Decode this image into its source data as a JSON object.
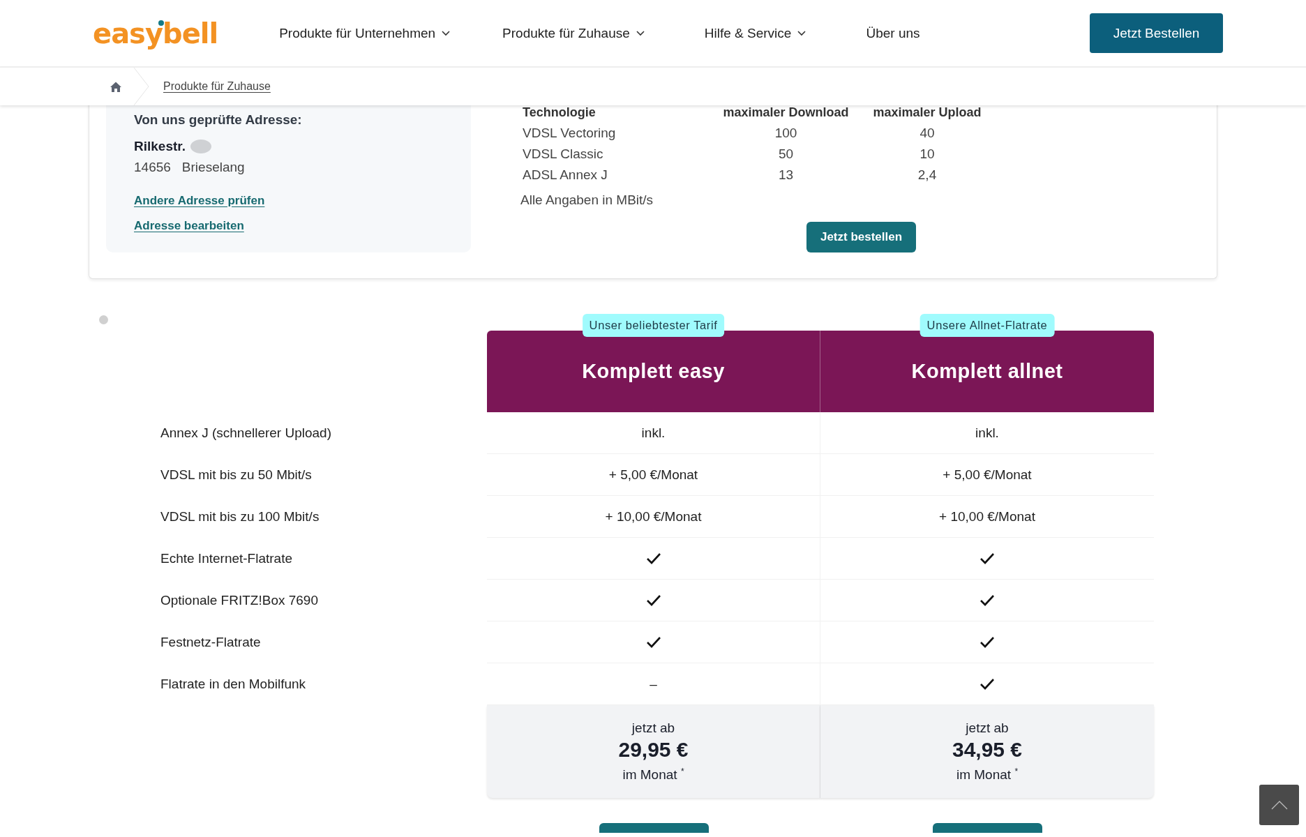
{
  "header": {
    "logo": "easybell",
    "nav": [
      {
        "label": "Produkte für Unternehmen",
        "has_menu": true
      },
      {
        "label": "Produkte für Zuhause",
        "has_menu": true
      },
      {
        "label": "Hilfe & Service",
        "has_menu": true
      },
      {
        "label": "Über uns",
        "has_menu": false
      }
    ],
    "cta": "Jetzt Bestellen"
  },
  "breadcrumb": {
    "items": [
      "Produkte für Zuhause"
    ]
  },
  "address": {
    "heading": "Von uns geprüfte Adresse:",
    "street": "Rilkestr.",
    "postcode": "14656",
    "city": "Brieselang",
    "links": [
      "Andere Adresse prüfen",
      "Adresse bearbeiten"
    ]
  },
  "speeds": {
    "columns": [
      "Technologie",
      "maximaler Download",
      "maximaler Upload"
    ],
    "rows": [
      [
        "VDSL Vectoring",
        "100",
        "40"
      ],
      [
        "VDSL Classic",
        "50",
        "10"
      ],
      [
        "ADSL Annex J",
        "13",
        "2,4"
      ]
    ],
    "note": "Alle Angaben in MBit/s",
    "button": "Jetzt bestellen"
  },
  "plans": [
    {
      "badge": "Unser beliebtester Tarif",
      "name": "Komplett easy",
      "price_prefix": "jetzt ab",
      "price": "29,95 €",
      "price_suffix": "im Monat $^{*}$"
    },
    {
      "badge": "Unsere Allnet-Flatrate",
      "name": "Komplett allnet",
      "price_prefix": "jetzt ab",
      "price": "34,95 €",
      "price_suffix": "im Monat $^{*}$"
    }
  ],
  "features": [
    {
      "label": "Annex J (schnellerer Upload)",
      "cells": [
        {
          "kind": "text",
          "text": "inkl."
        },
        {
          "kind": "text",
          "text": "inkl."
        }
      ]
    },
    {
      "label": "VDSL mit bis zu 50 Mbit/s",
      "cells": [
        {
          "kind": "text",
          "text": "+ 5,00 €/Monat"
        },
        {
          "kind": "text",
          "text": "+ 5,00 €/Monat"
        }
      ]
    },
    {
      "label": "VDSL mit bis zu 100 Mbit/s",
      "cells": [
        {
          "kind": "text",
          "text": "+ 10,00 €/Monat"
        },
        {
          "kind": "text",
          "text": "+ 10,00 €/Monat"
        }
      ]
    },
    {
      "label": "Echte Internet-Flatrate",
      "cells": [
        {
          "kind": "check"
        },
        {
          "kind": "check"
        }
      ]
    },
    {
      "label": "Optionale FRITZ!Box 7690",
      "cells": [
        {
          "kind": "check"
        },
        {
          "kind": "check"
        }
      ]
    },
    {
      "label": "Festnetz-Flatrate",
      "cells": [
        {
          "kind": "check"
        },
        {
          "kind": "check"
        }
      ]
    },
    {
      "label": "Flatrate in den Mobilfunk",
      "cells": [
        {
          "kind": "text",
          "text": "–"
        },
        {
          "kind": "check"
        }
      ]
    }
  ]
}
